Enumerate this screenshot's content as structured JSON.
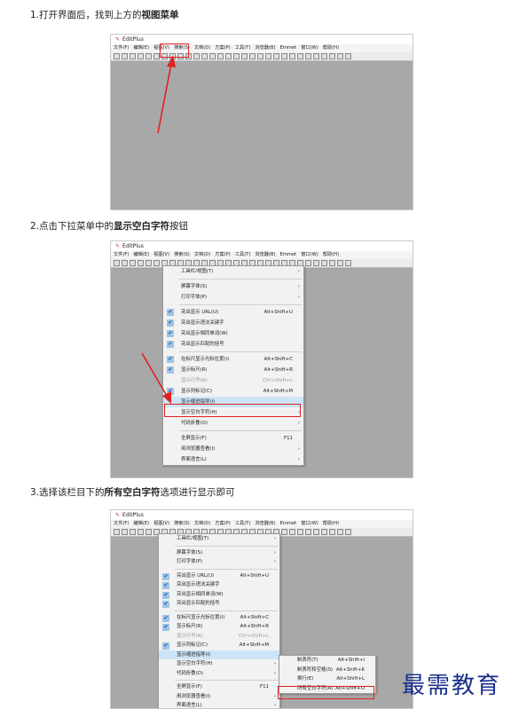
{
  "steps": [
    {
      "pre": "1.打开界面后，找到上方的",
      "bold": "视图菜单",
      "post": ""
    },
    {
      "pre": "2.点击下拉菜单中的",
      "bold": "显示空白字符",
      "post": "按钮"
    },
    {
      "pre": "3.选择该栏目下的",
      "bold": "所有空白字符",
      "post": "选项进行显示即可"
    }
  ],
  "app": {
    "title": "EditPlus"
  },
  "menubar": [
    "文件(F)",
    "编辑(E)",
    "视图(V)",
    "搜索(S)",
    "文档(D)",
    "方案(P)",
    "工具(T)",
    "浏览器(B)",
    "Emmet",
    "窗口(W)",
    "帮助(H)"
  ],
  "view_menu": [
    {
      "label": "工具栏/视图(T)",
      "arrow": true
    },
    {
      "sep": true
    },
    {
      "label": "屏幕字体(S)",
      "arrow": true
    },
    {
      "label": "打印字体(P)",
      "arrow": true
    },
    {
      "sep": true
    },
    {
      "label": "突出显示 URL(U)",
      "shortcut": "Alt+Shift+U",
      "checked": true
    },
    {
      "label": "突出显示语法关键字",
      "checked": true
    },
    {
      "label": "突出显示相同单词(W)",
      "checked": true
    },
    {
      "label": "突出显示匹配的括号",
      "checked": true
    },
    {
      "sep": true
    },
    {
      "label": "在标尺显示光标位置(I)",
      "shortcut": "Alt+Shift+C",
      "checked": true
    },
    {
      "label": "显示标尺(R)",
      "shortcut": "Alt+Shift+R",
      "checked": true
    },
    {
      "label": "显示行号(N)",
      "shortcut": "Ctrl+Shift+L",
      "disabled": true
    },
    {
      "label": "显示列标记(C)",
      "shortcut": "Alt+Shift+M",
      "checked": true
    },
    {
      "label": "显示缩进指导(I)",
      "highlight": true
    },
    {
      "label": "显示空白字符(H)",
      "arrow": true
    },
    {
      "label": "代码折叠(O)",
      "arrow": true
    },
    {
      "sep": true
    },
    {
      "label": "全屏显示(F)",
      "shortcut": "F11"
    },
    {
      "label": "用浏览器查看(I)",
      "arrow": true
    },
    {
      "label": "界面语言(L)",
      "arrow": true
    }
  ],
  "whitespace_submenu": [
    {
      "label": "制表符(T)",
      "shortcut": "Alt+Shift+I"
    },
    {
      "label": "制表符和空格(S)",
      "shortcut": "Alt+Shift+K"
    },
    {
      "label": "换行(E)",
      "shortcut": "Alt+Shift+L"
    },
    {
      "label": "所有空白字符(A)",
      "shortcut": "Alt+Shift+O"
    }
  ],
  "watermark": "最需教育",
  "colors": {
    "highlight": "#e02020",
    "watermark": "#1a2e8a"
  }
}
